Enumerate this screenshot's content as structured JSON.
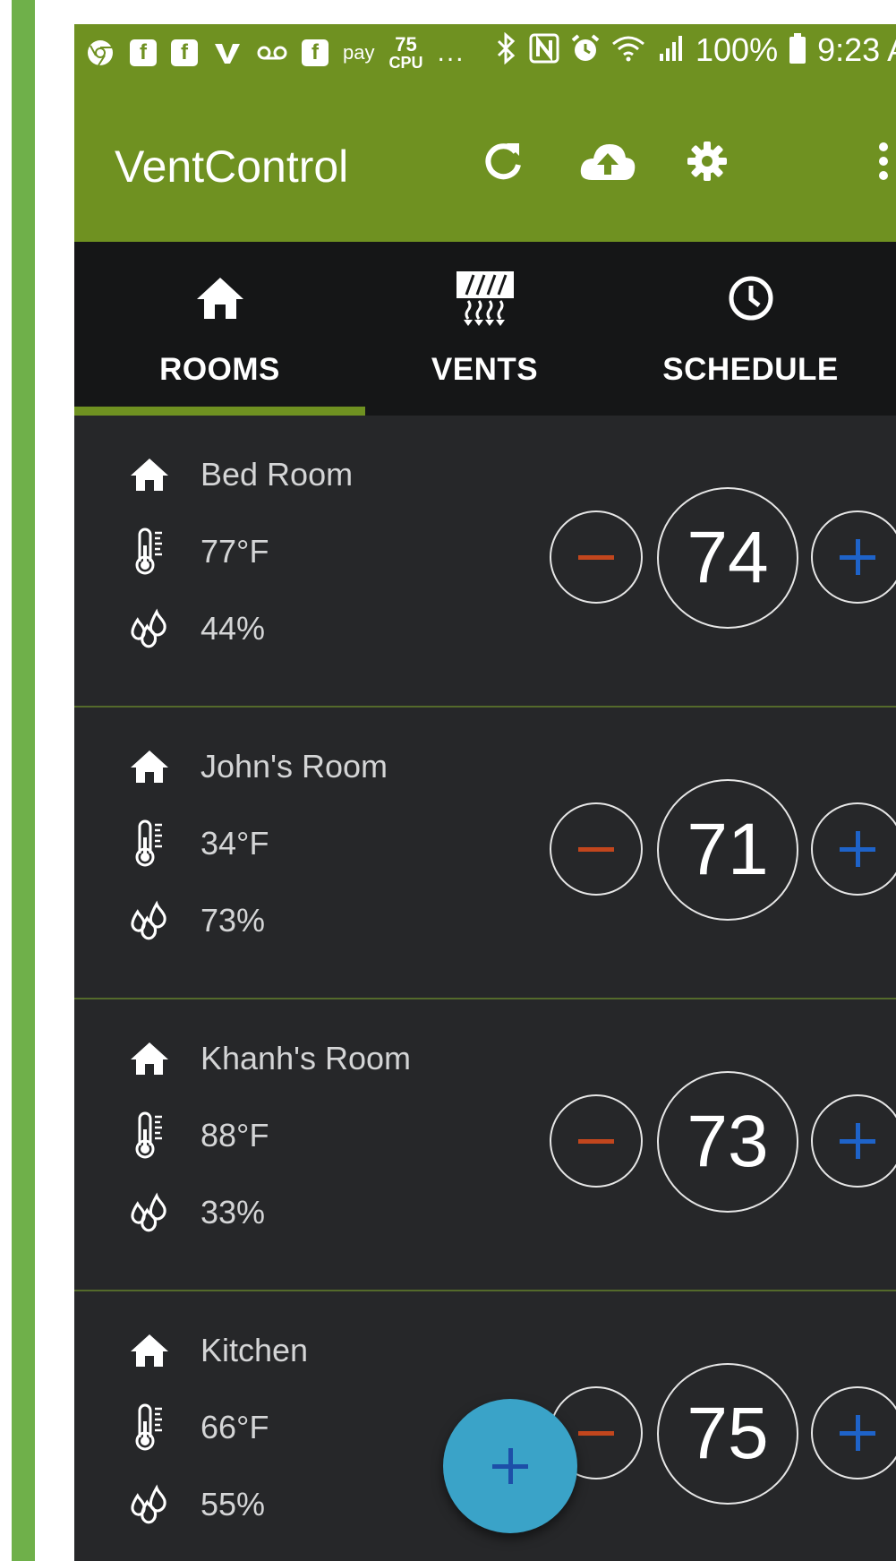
{
  "status_bar": {
    "pay_label": "pay",
    "cpu_value": "75",
    "cpu_label": "CPU",
    "more_notifications": "...",
    "battery_percent": "100%",
    "time": "9:23 A"
  },
  "app_bar": {
    "title": "VentControl",
    "actions": [
      "refresh-icon",
      "cloud-upload-icon",
      "gear-icon",
      "more-vert-icon"
    ]
  },
  "tabs": [
    {
      "label": "ROOMS",
      "icon": "home-icon",
      "selected": true
    },
    {
      "label": "VENTS",
      "icon": "vent-icon",
      "selected": false
    },
    {
      "label": "SCHEDULE",
      "icon": "clock-icon",
      "selected": false
    }
  ],
  "rooms": [
    {
      "name": "Bed Room",
      "temperature": "77°F",
      "humidity": "44%",
      "setpoint": "74"
    },
    {
      "name": "John's Room",
      "temperature": "34°F",
      "humidity": "73%",
      "setpoint": "71"
    },
    {
      "name": "Khanh's Room",
      "temperature": "88°F",
      "humidity": "33%",
      "setpoint": "73"
    },
    {
      "name": "Kitchen",
      "temperature": "66°F",
      "humidity": "55%",
      "setpoint": "75"
    }
  ],
  "fab": {
    "icon": "add-icon"
  },
  "colors": {
    "app_bar": "#6f9121",
    "tab_bar": "#151617",
    "card_background": "#262729",
    "decrement_sign": "#c2461d",
    "increment_sign": "#1e63c9",
    "fab": "#3aa3c8",
    "side_accent": "#6fb04a"
  }
}
